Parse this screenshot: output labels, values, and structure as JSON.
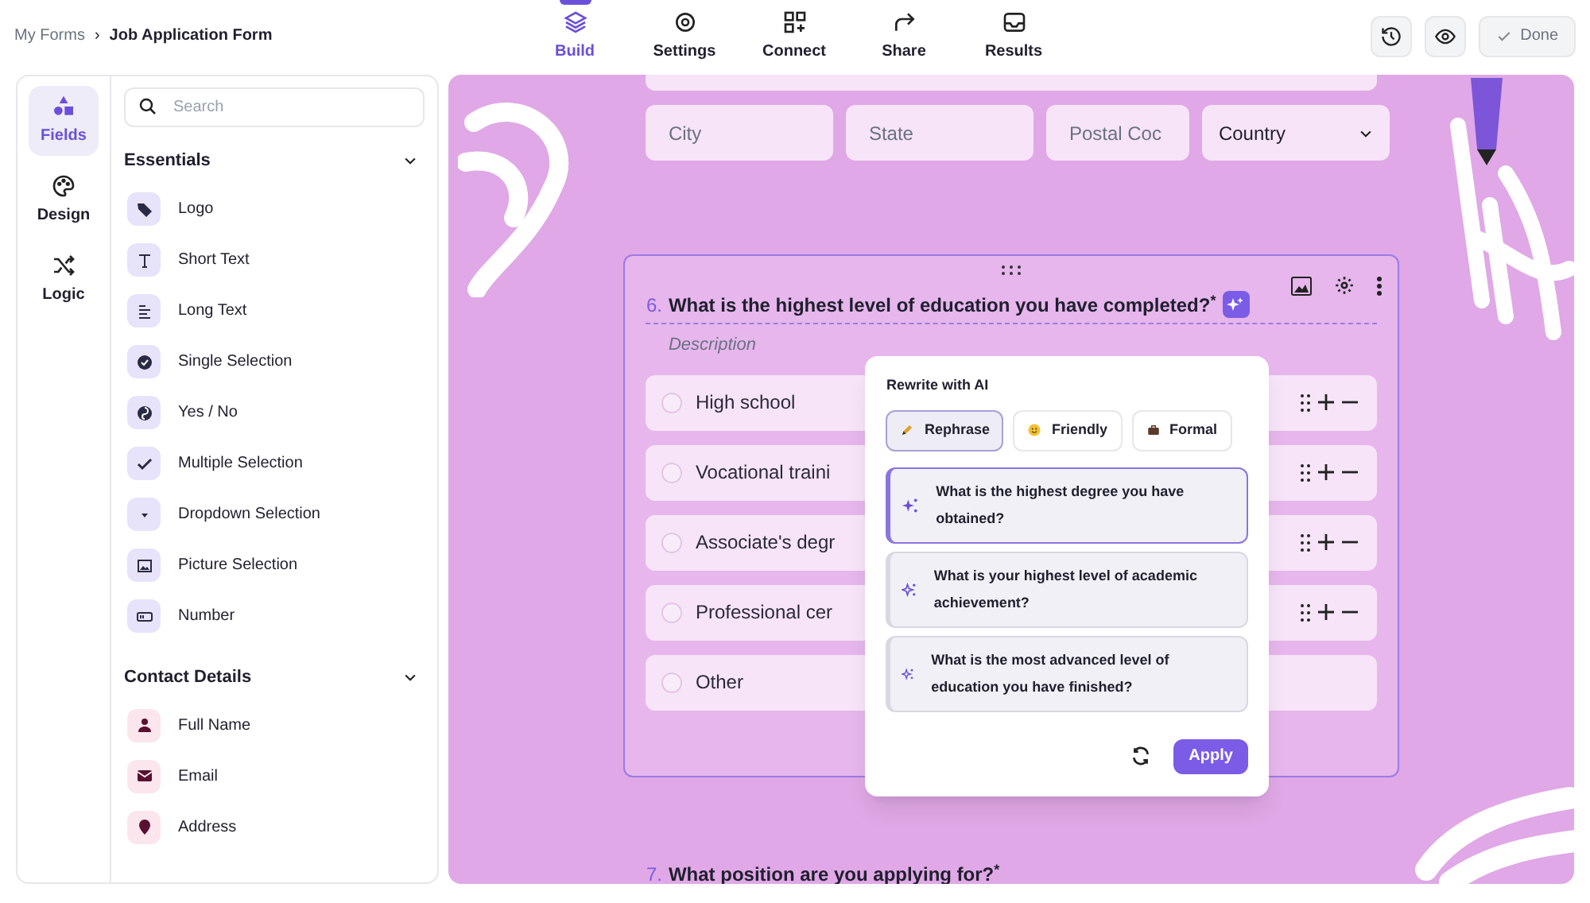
{
  "breadcrumb": {
    "parent": "My Forms",
    "separator": "›",
    "current": "Job Application Form"
  },
  "nav_tabs": [
    {
      "label": "Build",
      "selected": true
    },
    {
      "label": "Settings",
      "selected": false
    },
    {
      "label": "Connect",
      "selected": false
    },
    {
      "label": "Share",
      "selected": false
    },
    {
      "label": "Results",
      "selected": false
    }
  ],
  "done_button": "Done",
  "rail": [
    {
      "label": "Fields",
      "selected": true
    },
    {
      "label": "Design",
      "selected": false
    },
    {
      "label": "Logic",
      "selected": false
    }
  ],
  "search": {
    "placeholder": "Search"
  },
  "sections": [
    {
      "title": "Essentials",
      "expanded": true,
      "color": "#e6e3fb",
      "items": [
        {
          "label": "Logo"
        },
        {
          "label": "Short Text"
        },
        {
          "label": "Long Text"
        },
        {
          "label": "Single Selection"
        },
        {
          "label": "Yes / No"
        },
        {
          "label": "Multiple Selection"
        },
        {
          "label": "Dropdown Selection"
        },
        {
          "label": "Picture Selection"
        },
        {
          "label": "Number"
        }
      ]
    },
    {
      "title": "Contact Details",
      "expanded": true,
      "color": "#fbe6ee",
      "items": [
        {
          "label": "Full Name"
        },
        {
          "label": "Email"
        },
        {
          "label": "Address"
        }
      ]
    }
  ],
  "address_fields": [
    {
      "kind": "input",
      "placeholder": "City"
    },
    {
      "kind": "input",
      "placeholder": "State"
    },
    {
      "kind": "input",
      "placeholder": "Postal Coc"
    },
    {
      "kind": "select",
      "value": "Country"
    }
  ],
  "question": {
    "number": "6.",
    "text": "What is the highest level of education you have completed?$^{*}$",
    "description_placeholder": "Description",
    "options": [
      {
        "label": "High school",
        "controls": true
      },
      {
        "label": "Vocational traini",
        "controls": true
      },
      {
        "label": "Associate's degr",
        "controls": true
      },
      {
        "label": "Professional cer",
        "controls": true
      },
      {
        "label": "Other",
        "controls": false
      }
    ]
  },
  "rewrite_popup": {
    "title": "Rewrite with AI",
    "tones": [
      {
        "label": "Rephrase",
        "selected": true
      },
      {
        "label": "Friendly",
        "selected": false
      },
      {
        "label": "Formal",
        "selected": false
      }
    ],
    "suggestions": [
      {
        "text": "What is the highest degree you have obtained?",
        "selected": true
      },
      {
        "text": "What is your highest level of academic achievement?",
        "selected": false
      },
      {
        "text": "What is the most advanced level of education you have finished?",
        "selected": false
      }
    ],
    "apply": "Apply"
  },
  "next_question": {
    "number": "7.",
    "text": "What position are you applying for?$^{*}$"
  }
}
